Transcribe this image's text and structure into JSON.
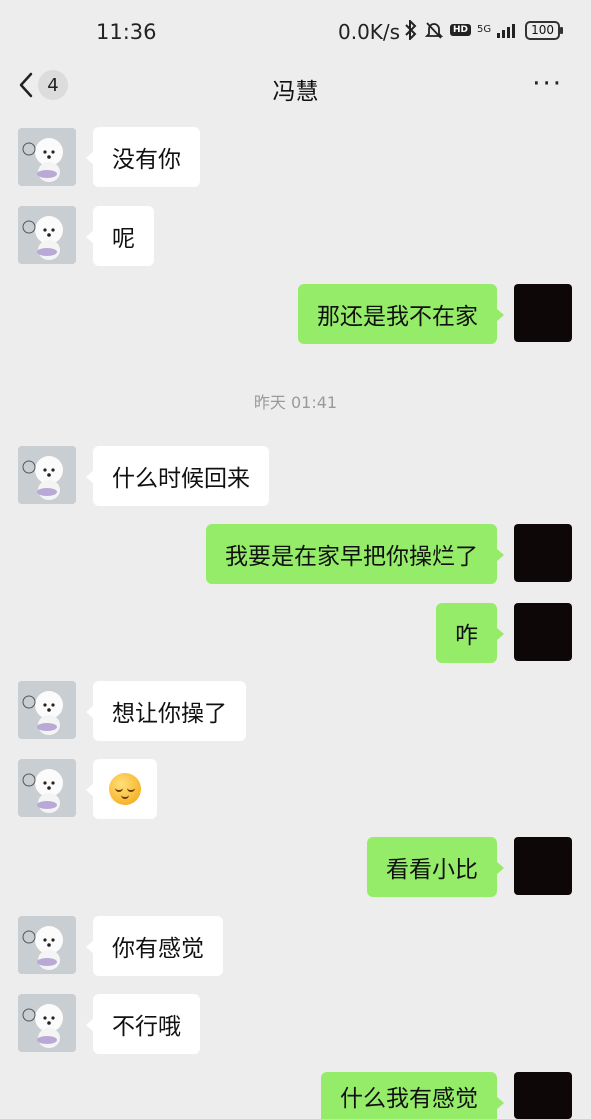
{
  "status_bar": {
    "time": "11:36",
    "network_speed": "0.0K/s",
    "network_type": "5G",
    "battery": "100"
  },
  "header": {
    "unread_count": "4",
    "title": "冯慧",
    "more": "···"
  },
  "messages": [
    {
      "side": "in",
      "text": "没有你"
    },
    {
      "side": "in",
      "text": "呢"
    },
    {
      "side": "out",
      "text": "那还是我不在家"
    },
    {
      "side": "in",
      "text": "什么时候回来"
    },
    {
      "side": "out",
      "text": "我要是在家早把你操烂了"
    },
    {
      "side": "out",
      "text": "咋"
    },
    {
      "side": "in",
      "text": "想让你操了"
    },
    {
      "side": "in",
      "emoji": "blushing-face-icon"
    },
    {
      "side": "out",
      "text": "看看小比"
    },
    {
      "side": "in",
      "text": "你有感觉"
    },
    {
      "side": "in",
      "text": "不行哦"
    },
    {
      "side": "out",
      "text": "什么我有感觉"
    }
  ],
  "timestamp": "昨天 01:41"
}
